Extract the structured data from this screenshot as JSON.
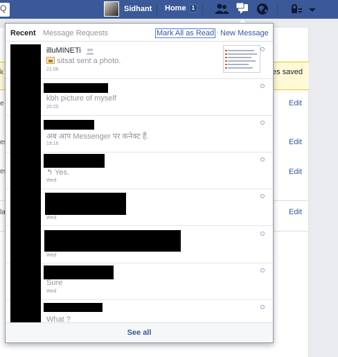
{
  "topbar": {
    "search_glyph": "Q",
    "profile_name": "Sidhant",
    "home_label": "Home",
    "home_badge": "1",
    "icons": [
      "friend-requests-icon",
      "messages-icon",
      "notifications-icon",
      "privacy-lock-icon",
      "account-menu-icon"
    ]
  },
  "page": {
    "left_edge_k": "k",
    "saved_text": "es saved",
    "edit_label": "Edit",
    "edge_chars": [
      "e",
      "es",
      "es",
      "la"
    ]
  },
  "flyout": {
    "tab_recent": "Recent",
    "tab_requests": "Message Requests",
    "mark_all_read": "Mark All as Read",
    "separator": "·",
    "new_message": "New Message",
    "threads": [
      {
        "title": "illuMINETi",
        "snippet": "sitsat sent a photo.",
        "time": "21:06"
      },
      {
        "title": "",
        "snippet": "kbh picture of myself",
        "time": "20:25"
      },
      {
        "title": "",
        "snippet": "अब आप Messenger पर कनेक्ट हैं.",
        "time": "19:16"
      },
      {
        "title": "",
        "snippet": "Yes.",
        "time": "Wed"
      },
      {
        "title": "",
        "snippet": "",
        "time": "Wed"
      },
      {
        "title": "",
        "snippet": "",
        "time": "Wed"
      },
      {
        "title": "",
        "snippet": "Sure",
        "time": "Wed"
      },
      {
        "title": "",
        "snippet": "What ?",
        "time": ""
      }
    ],
    "see_all": "See all"
  },
  "colors": {
    "topbar": "#3b5998",
    "link": "#365899",
    "saved_strip": "#fff9d7"
  }
}
